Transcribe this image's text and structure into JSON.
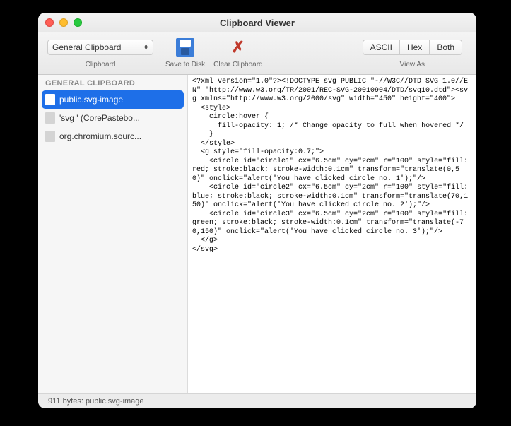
{
  "window": {
    "title": "Clipboard Viewer"
  },
  "toolbar": {
    "clipboard_selector": "General Clipboard",
    "clipboard_label": "Clipboard",
    "save_label": "Save to Disk",
    "clear_label": "Clear Clipboard",
    "view_as_label": "View As",
    "segments": [
      "ASCII",
      "Hex",
      "Both"
    ]
  },
  "sidebar": {
    "header": "GENERAL CLIPBOARD",
    "items": [
      {
        "label": "public.svg-image",
        "selected": true
      },
      {
        "label": "'svg ' (CorePastebo...",
        "selected": false
      },
      {
        "label": "org.chromium.sourc...",
        "selected": false
      }
    ]
  },
  "content_text": "<?xml version=\"1.0\"?><!DOCTYPE svg PUBLIC \"-//W3C//DTD SVG 1.0//EN\" \"http://www.w3.org/TR/2001/REC-SVG-20010904/DTD/svg10.dtd\"><svg xmlns=\"http://www.w3.org/2000/svg\" width=\"450\" height=\"400\">\n  <style>\n    circle:hover {\n      fill-opacity: 1; /* Change opacity to full when hovered */\n    }\n  </style>\n  <g style=\"fill-opacity:0.7;\">\n    <circle id=\"circle1\" cx=\"6.5cm\" cy=\"2cm\" r=\"100\" style=\"fill:red; stroke:black; stroke-width:0.1cm\" transform=\"translate(0,50)\" onclick=\"alert('You have clicked circle no. 1');\"/>\n    <circle id=\"circle2\" cx=\"6.5cm\" cy=\"2cm\" r=\"100\" style=\"fill:blue; stroke:black; stroke-width:0.1cm\" transform=\"translate(70,150)\" onclick=\"alert('You have clicked circle no. 2');\"/>\n    <circle id=\"circle3\" cx=\"6.5cm\" cy=\"2cm\" r=\"100\" style=\"fill:green; stroke:black; stroke-width:0.1cm\" transform=\"translate(-70,150)\" onclick=\"alert('You have clicked circle no. 3');\"/>\n  </g>\n</svg>",
  "statusbar": {
    "text": "911 bytes: public.svg-image"
  }
}
